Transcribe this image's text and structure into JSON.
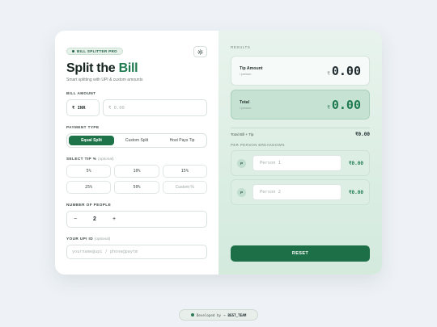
{
  "header": {
    "badge": "BILL SPLITTER PRO",
    "title_main": "Split the ",
    "title_accent": "Bill",
    "subtitle": "Smart splitting with UPI & custom amounts"
  },
  "bill": {
    "label": "BILL AMOUNT",
    "currency": "₹ INR",
    "placeholder": "₹ 0.00"
  },
  "payment_type": {
    "label": "PAYMENT TYPE",
    "options": [
      "Equal Split",
      "Custom Split",
      "Host Pays Tip"
    ],
    "selected": "Equal Split"
  },
  "tip": {
    "label": "SELECT TIP %",
    "optional": "(optional)",
    "options": [
      "5%",
      "10%",
      "15%",
      "25%",
      "50%"
    ],
    "custom_placeholder": "Custom %"
  },
  "people": {
    "label": "NUMBER OF PEOPLE",
    "minus": "−",
    "plus": "+",
    "count": "2"
  },
  "upi": {
    "label": "YOUR UPI ID",
    "optional": "(optional)",
    "placeholder": "yourname@upi / phone@paytm"
  },
  "results": {
    "label": "RESULTS",
    "tip_amount": {
      "label": "Tip Amount",
      "sub": "/ person",
      "currency": "₹",
      "value": "0.00"
    },
    "total": {
      "label": "Total",
      "sub": "/ person",
      "currency": "₹",
      "value": "0.00"
    },
    "total_bill_label": "Total Bill + Tip",
    "total_bill_value": "₹0.00",
    "breakdown_label": "PER PERSON BREAKDOWN",
    "persons": [
      {
        "initial": "P",
        "placeholder": "Person 1",
        "amount": "₹0.00"
      },
      {
        "initial": "P",
        "placeholder": "Person 2",
        "amount": "₹0.00"
      }
    ],
    "reset_label": "RESET"
  },
  "footer": {
    "prefix": "Developed by",
    "arrow": "→",
    "name": "BEST_TEAM"
  },
  "colors": {
    "accent": "#1f7a50",
    "button": "#1c6f46",
    "panel": "#d3eadd"
  }
}
